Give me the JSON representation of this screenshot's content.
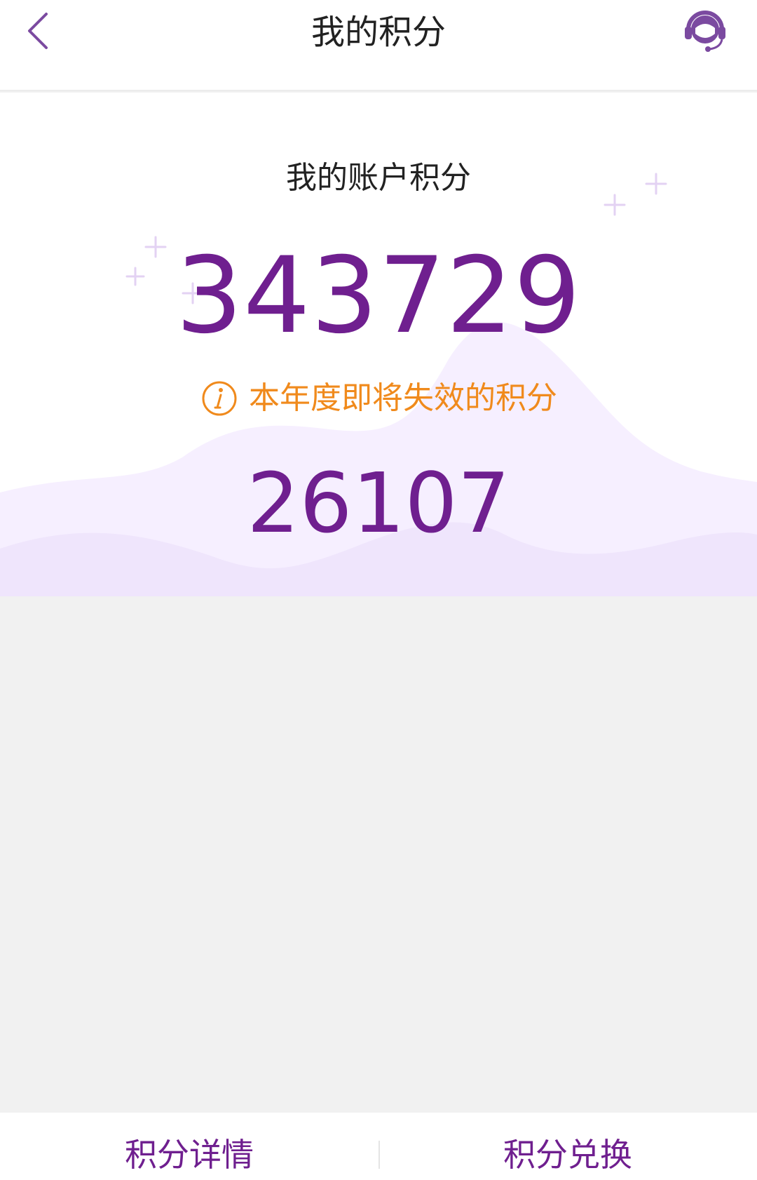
{
  "header": {
    "title": "我的积分",
    "back_icon": "chevron-left-icon",
    "service_icon": "customer-service-icon"
  },
  "points": {
    "account_label": "我的账户积分",
    "total": "343729",
    "expiring_label": "本年度即将失效的积分",
    "expiring_value": "26107"
  },
  "bottom_bar": {
    "details_label": "积分详情",
    "exchange_label": "积分兑换"
  },
  "colors": {
    "accent": "#6f1f8f",
    "warning": "#f08a1c",
    "icon_purple": "#7b4aa0",
    "background": "#f1f1f1"
  }
}
